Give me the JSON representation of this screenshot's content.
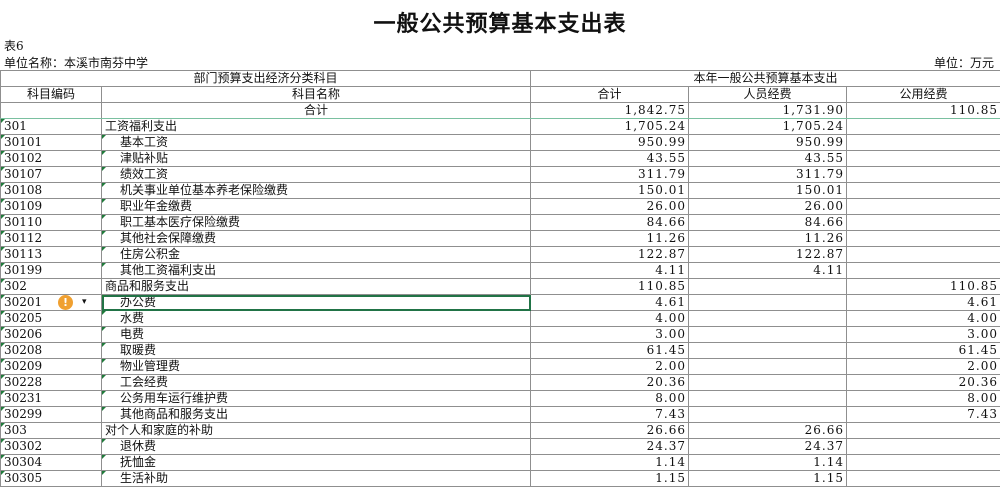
{
  "title": "一般公共预算基本支出表",
  "table_no": "表6",
  "unit_name": "单位名称：本溪市南芬中学",
  "unit": "单位：万元",
  "header": {
    "group_left": "部门预算支出经济分类科目",
    "group_right": "本年一般公共预算基本支出",
    "col_code": "科目编码",
    "col_name": "科目名称",
    "col_total": "合计",
    "col_personnel": "人员经费",
    "col_public": "公用经费"
  },
  "total_row": {
    "label": "合计",
    "total": "1,842.75",
    "personnel": "1,731.90",
    "public": "110.85"
  },
  "rows": [
    {
      "code": "301",
      "name": "工资福利支出",
      "total": "1,705.24",
      "personnel": "1,705.24",
      "public": ""
    },
    {
      "code": "30101",
      "name": "基本工资",
      "total": "950.99",
      "personnel": "950.99",
      "public": ""
    },
    {
      "code": "30102",
      "name": "津贴补贴",
      "total": "43.55",
      "personnel": "43.55",
      "public": ""
    },
    {
      "code": "30107",
      "name": "绩效工资",
      "total": "311.79",
      "personnel": "311.79",
      "public": ""
    },
    {
      "code": "30108",
      "name": "机关事业单位基本养老保险缴费",
      "total": "150.01",
      "personnel": "150.01",
      "public": ""
    },
    {
      "code": "30109",
      "name": "职业年金缴费",
      "total": "26.00",
      "personnel": "26.00",
      "public": ""
    },
    {
      "code": "30110",
      "name": "职工基本医疗保险缴费",
      "total": "84.66",
      "personnel": "84.66",
      "public": ""
    },
    {
      "code": "30112",
      "name": "其他社会保障缴费",
      "total": "11.26",
      "personnel": "11.26",
      "public": ""
    },
    {
      "code": "30113",
      "name": "住房公积金",
      "total": "122.87",
      "personnel": "122.87",
      "public": ""
    },
    {
      "code": "30199",
      "name": "其他工资福利支出",
      "total": "4.11",
      "personnel": "4.11",
      "public": ""
    },
    {
      "code": "302",
      "name": "商品和服务支出",
      "total": "110.85",
      "personnel": "",
      "public": "110.85"
    },
    {
      "code": "30201",
      "name": "办公费",
      "total": "4.61",
      "personnel": "",
      "public": "4.61"
    },
    {
      "code": "30205",
      "name": "水费",
      "total": "4.00",
      "personnel": "",
      "public": "4.00"
    },
    {
      "code": "30206",
      "name": "电费",
      "total": "3.00",
      "personnel": "",
      "public": "3.00"
    },
    {
      "code": "30208",
      "name": "取暖费",
      "total": "61.45",
      "personnel": "",
      "public": "61.45"
    },
    {
      "code": "30209",
      "name": "物业管理费",
      "total": "2.00",
      "personnel": "",
      "public": "2.00"
    },
    {
      "code": "30228",
      "name": "工会经费",
      "total": "20.36",
      "personnel": "",
      "public": "20.36"
    },
    {
      "code": "30231",
      "name": "公务用车运行维护费",
      "total": "8.00",
      "personnel": "",
      "public": "8.00"
    },
    {
      "code": "30299",
      "name": "其他商品和服务支出",
      "total": "7.43",
      "personnel": "",
      "public": "7.43"
    },
    {
      "code": "303",
      "name": "对个人和家庭的补助",
      "total": "26.66",
      "personnel": "26.66",
      "public": ""
    },
    {
      "code": "30302",
      "name": "退休费",
      "total": "24.37",
      "personnel": "24.37",
      "public": ""
    },
    {
      "code": "30304",
      "name": "抚恤金",
      "total": "1.14",
      "personnel": "1.14",
      "public": ""
    },
    {
      "code": "30305",
      "name": "生活补助",
      "total": "1.15",
      "personnel": "1.15",
      "public": ""
    }
  ],
  "warning_icon": "!",
  "warning_caret": "▾"
}
